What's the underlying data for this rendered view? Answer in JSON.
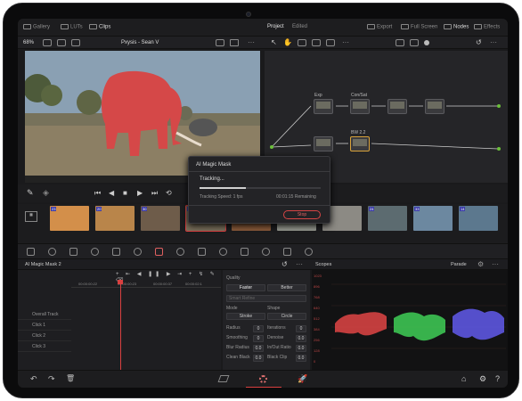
{
  "topbar": {
    "tabs": [
      "Gallery",
      "LUTs",
      "Clips"
    ],
    "center_tabs": [
      "Project",
      "Edited"
    ],
    "right_tabs": [
      "Export",
      "Full Screen",
      "Nodes",
      "Effects"
    ]
  },
  "viewer": {
    "zoom": "68%",
    "clip_title": "Pxysis - Sean V"
  },
  "nodes": [
    {
      "label": "Exp"
    },
    {
      "label": "Con/Sat"
    },
    {
      "label": ""
    },
    {
      "label": ""
    },
    {
      "label": ""
    },
    {
      "label": "BW 2.2"
    }
  ],
  "dialog": {
    "title": "AI Magic Mask",
    "status": "Tracking...",
    "speed": "Tracking Speed: 1 fps",
    "remaining": "00:01:15 Remaining",
    "progress": 0.38,
    "stop": "Stop"
  },
  "thumbs": [
    {
      "num": "23",
      "color": "#d38f4a"
    },
    {
      "num": "20",
      "color": "#b9854a"
    },
    {
      "num": "30",
      "color": "#6e5c4a"
    },
    {
      "num": "14",
      "color": "#7a6f5a"
    },
    {
      "num": "13",
      "color": "#8a5a3a"
    },
    {
      "num": "22",
      "color": "#95988f"
    },
    {
      "num": "28",
      "color": "#8c8a84"
    },
    {
      "num": "24",
      "color": "#5c6b70"
    },
    {
      "num": "33",
      "color": "#6c88a0"
    },
    {
      "num": "14",
      "color": "#5c788e"
    }
  ],
  "mask_panel": {
    "title": "AI Magic Mask 2",
    "timecodes": [
      "00:00:00:22",
      "00:00:00:23",
      "00:00:00:37",
      "00:00:02:1"
    ],
    "tracks": [
      "Overall Track",
      "Click 1",
      "Click 2",
      "Click 3"
    ],
    "quality_label": "Quality",
    "quality_options": [
      "Faster",
      "Better"
    ],
    "smart_refine": "Smart Refine",
    "mode_label": "Mode",
    "mode_value": "Stroke",
    "shape_label": "Shape",
    "shape_value": "Circle",
    "params": [
      {
        "l": "Radius",
        "v": "0",
        "r": "Iterations",
        "rv": "0"
      },
      {
        "l": "Smoothing",
        "v": "0",
        "r": "Denoise",
        "rv": "0.0"
      },
      {
        "l": "Blur Radius",
        "v": "0.0",
        "r": "In/Out Ratio",
        "rv": "0.0"
      },
      {
        "l": "Clean Black",
        "v": "0.0",
        "r": "Black Clip",
        "rv": "0.0"
      }
    ]
  },
  "scopes": {
    "title": "Scopes",
    "mode": "Parade",
    "scale": [
      "1023",
      "896",
      "768",
      "640",
      "512",
      "384",
      "256",
      "128",
      "0"
    ]
  }
}
